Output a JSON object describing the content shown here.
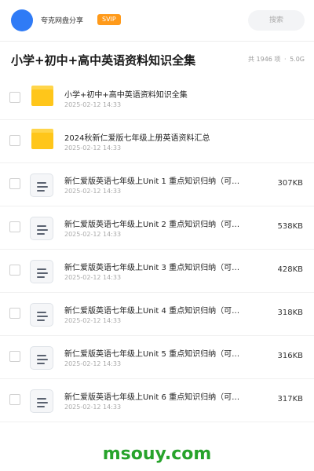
{
  "header": {
    "username": "夸克网盘分享",
    "badge": "SVIP",
    "search_placeholder": "搜索"
  },
  "page": {
    "title": "小学+初中+高中英语资料知识全集",
    "count_text": "共 1946 项",
    "separator": "·",
    "total_size": "5.0G"
  },
  "files": [
    {
      "type": "folder",
      "name": "小学+初中+高中英语资料知识全集",
      "date": "2025-02-12 14:33",
      "size": ""
    },
    {
      "type": "folder",
      "name": "2024秋新仁爱版七年级上册英语资料汇总",
      "date": "2025-02-12 14:33",
      "size": ""
    },
    {
      "type": "doc",
      "name": "新仁爱版英语七年级上Unit 1 重点知识归纳（可…",
      "date": "2025-02-12 14:33",
      "size": "307KB"
    },
    {
      "type": "doc",
      "name": "新仁爱版英语七年级上Unit 2 重点知识归纳（可…",
      "date": "2025-02-12 14:33",
      "size": "538KB"
    },
    {
      "type": "doc",
      "name": "新仁爱版英语七年级上Unit 3 重点知识归纳（可…",
      "date": "2025-02-12 14:33",
      "size": "428KB"
    },
    {
      "type": "doc",
      "name": "新仁爱版英语七年级上Unit 4 重点知识归纳（可…",
      "date": "2025-02-12 14:33",
      "size": "318KB"
    },
    {
      "type": "doc",
      "name": "新仁爱版英语七年级上Unit 5 重点知识归纳（可…",
      "date": "2025-02-12 14:33",
      "size": "316KB"
    },
    {
      "type": "doc",
      "name": "新仁爱版英语七年级上Unit 6 重点知识归纳（可…",
      "date": "2025-02-12 14:33",
      "size": "317KB"
    }
  ],
  "watermark": "msouy.com"
}
